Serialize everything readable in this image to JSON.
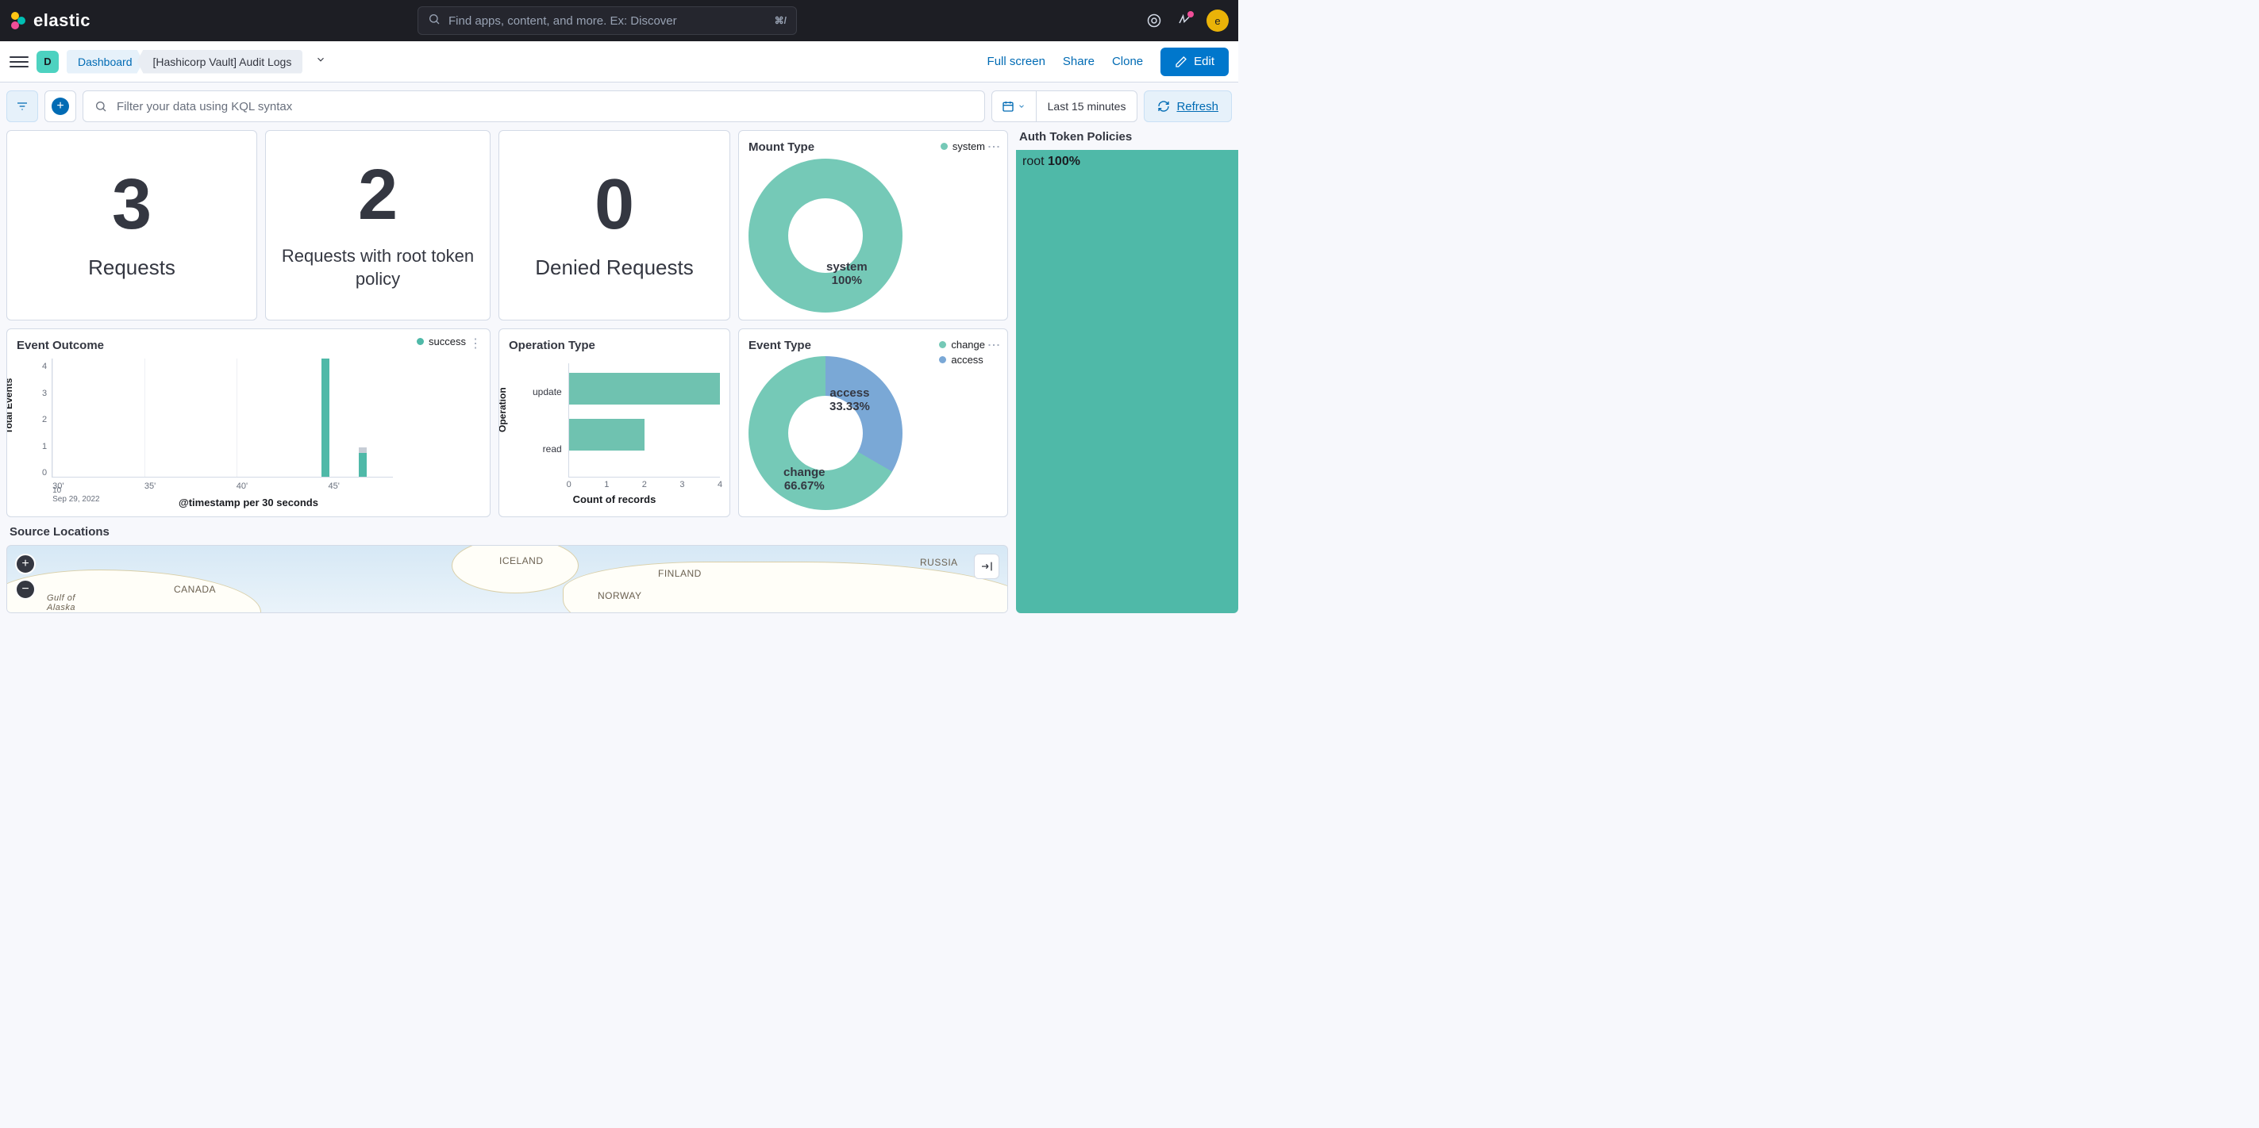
{
  "header": {
    "logo_text": "elastic",
    "search_placeholder": "Find apps, content, and more. Ex: Discover",
    "search_kbd": "⌘/",
    "avatar": "e"
  },
  "subhead": {
    "space_badge": "D",
    "crumb_dashboard": "Dashboard",
    "crumb_current": "[Hashicorp Vault] Audit Logs",
    "actions": {
      "full_screen": "Full screen",
      "share": "Share",
      "clone": "Clone",
      "edit": "Edit"
    }
  },
  "filterbar": {
    "query_placeholder": "Filter your data using KQL syntax",
    "time_label": "Last 15 minutes",
    "refresh": "Refresh"
  },
  "panels": {
    "requests": {
      "value": "3",
      "label": "Requests"
    },
    "root_requests": {
      "value": "2",
      "label": "Requests with root token policy"
    },
    "denied": {
      "value": "0",
      "label": "Denied Requests"
    },
    "mount_type": {
      "title": "Mount Type",
      "legend": [
        {
          "label": "system",
          "color": "#75c9b7"
        }
      ],
      "slice_label_name": "system",
      "slice_label_pct": "100%"
    },
    "auth": {
      "title": "Auth Token Policies",
      "label": "root",
      "pct": "100%"
    },
    "event_outcome": {
      "title": "Event Outcome",
      "ylabel": "Total Events",
      "xlabel": "@timestamp per 30 seconds",
      "legend": "success",
      "y_ticks": [
        "4",
        "3",
        "2",
        "1",
        "0"
      ],
      "x_ticks": [
        "30'",
        "35'",
        "40'",
        "45'"
      ],
      "sub1": "10",
      "sub2": "Sep 29, 2022"
    },
    "operation_type": {
      "title": "Operation Type",
      "ylabel": "Operation",
      "xlabel": "Count of records",
      "categories": [
        "update",
        "read"
      ],
      "x_ticks": [
        "0",
        "1",
        "2",
        "3",
        "4"
      ]
    },
    "event_type": {
      "title": "Event Type",
      "legend": [
        {
          "label": "change",
          "color": "#75c9b7"
        },
        {
          "label": "access",
          "color": "#7aa8d6"
        }
      ],
      "slice1_name": "access",
      "slice1_pct": "33.33%",
      "slice2_name": "change",
      "slice2_pct": "66.67%"
    },
    "map": {
      "title": "Source Locations",
      "regions": {
        "iceland": "ICELAND",
        "canada": "CANADA",
        "finland": "FINLAND",
        "norway": "NORWAY",
        "russia": "RUSSIA",
        "alaska": "Gulf of\nAlaska"
      }
    }
  },
  "chart_data": [
    {
      "type": "pie",
      "title": "Mount Type",
      "series": [
        {
          "name": "system",
          "value": 100
        }
      ]
    },
    {
      "type": "bar",
      "title": "Event Outcome",
      "xlabel": "@timestamp per 30 seconds",
      "ylabel": "Total Events",
      "ylim": [
        0,
        4
      ],
      "categories": [
        "10:30",
        "10:35",
        "10:40",
        "10:45"
      ],
      "series": [
        {
          "name": "success",
          "values": [
            0,
            0,
            4,
            1
          ]
        }
      ],
      "date": "Sep 29, 2022"
    },
    {
      "type": "bar",
      "orientation": "horizontal",
      "title": "Operation Type",
      "xlabel": "Count of records",
      "ylabel": "Operation",
      "xlim": [
        0,
        4
      ],
      "categories": [
        "update",
        "read"
      ],
      "values": [
        4,
        2
      ]
    },
    {
      "type": "pie",
      "title": "Event Type",
      "series": [
        {
          "name": "change",
          "value": 66.67
        },
        {
          "name": "access",
          "value": 33.33
        }
      ]
    },
    {
      "type": "bar",
      "title": "Auth Token Policies",
      "categories": [
        "root"
      ],
      "values": [
        100
      ]
    }
  ]
}
